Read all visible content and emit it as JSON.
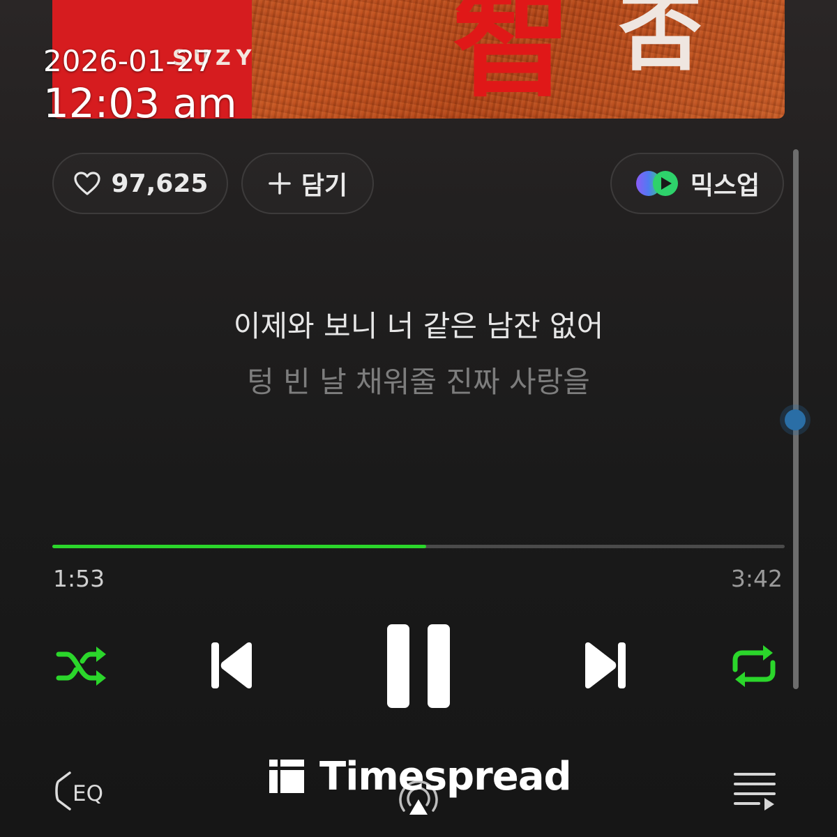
{
  "album": {
    "artist_text": "SUZY",
    "title_chars": [
      "智",
      "否"
    ]
  },
  "overlay": {
    "date": "2026-01-27",
    "time": "12:03 am"
  },
  "actions": {
    "like_count": "97,625",
    "add_label": "담기",
    "mixup_label": "믹스업"
  },
  "lyrics": {
    "current": "이제와 보니 너 같은 남잔 없어",
    "next": "텅 빈 날 채워줄 진짜 사랑을"
  },
  "playback": {
    "elapsed": "1:53",
    "total": "3:42",
    "progress_fraction": 0.51,
    "is_playing": true,
    "shuffle_on": true,
    "repeat_on": true
  },
  "bottom_bar": {
    "eq_label": "EQ",
    "icons": [
      "eq-icon",
      "airplay-icon",
      "playlist-icon"
    ]
  },
  "watermark": {
    "text": "Timespread"
  },
  "colors": {
    "accent_green": "#2bd62b",
    "background": "#1c1b1b",
    "lyric_current": "#e7e7e7",
    "lyric_next": "#7d7d7d",
    "scroll_thumb": "#2a6ea6"
  }
}
